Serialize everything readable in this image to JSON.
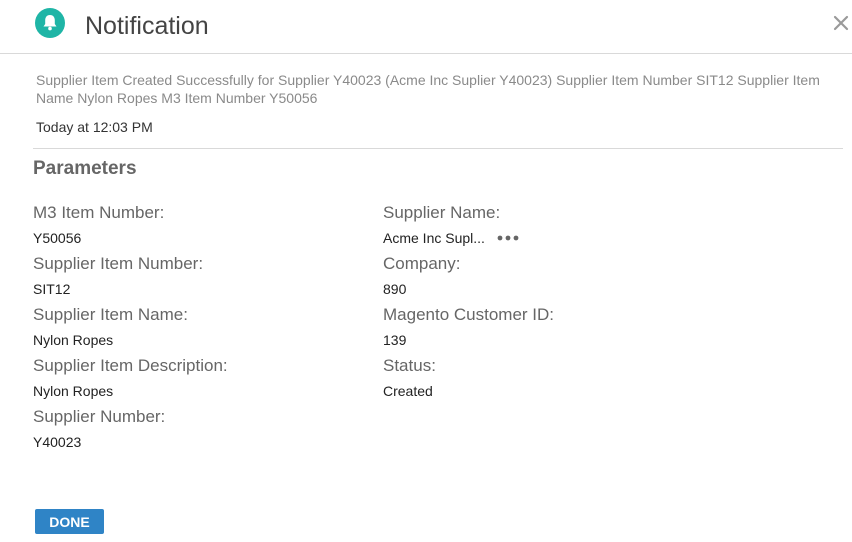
{
  "header": {
    "title": "Notification",
    "icon": "bell-icon",
    "close_icon": "close-icon",
    "accent_color": "#1fb5a6"
  },
  "message": "Supplier Item Created Successfully for Supplier Y40023 (Acme Inc Suplier Y40023) Supplier Item Number SIT12 Supplier Item Name Nylon Ropes M3 Item Number Y50056",
  "timestamp": "Today at 12:03 PM",
  "parameters": {
    "title": "Parameters",
    "left": [
      {
        "label": "M3 Item Number:",
        "value": "Y50056"
      },
      {
        "label": "Supplier Item Number:",
        "value": "SIT12"
      },
      {
        "label": "Supplier Item Name:",
        "value": "Nylon Ropes"
      },
      {
        "label": "Supplier Item Description:",
        "value": "Nylon Ropes"
      },
      {
        "label": "Supplier Number:",
        "value": "Y40023"
      }
    ],
    "right": [
      {
        "label": "Supplier Name:",
        "value": "Acme Inc Supl...",
        "more_icon": "more-icon"
      },
      {
        "label": "Company:",
        "value": "890"
      },
      {
        "label": "Magento Customer ID:",
        "value": "139"
      },
      {
        "label": "Status:",
        "value": "Created"
      }
    ]
  },
  "footer": {
    "done_label": "DONE",
    "button_color": "#2f84c6"
  }
}
